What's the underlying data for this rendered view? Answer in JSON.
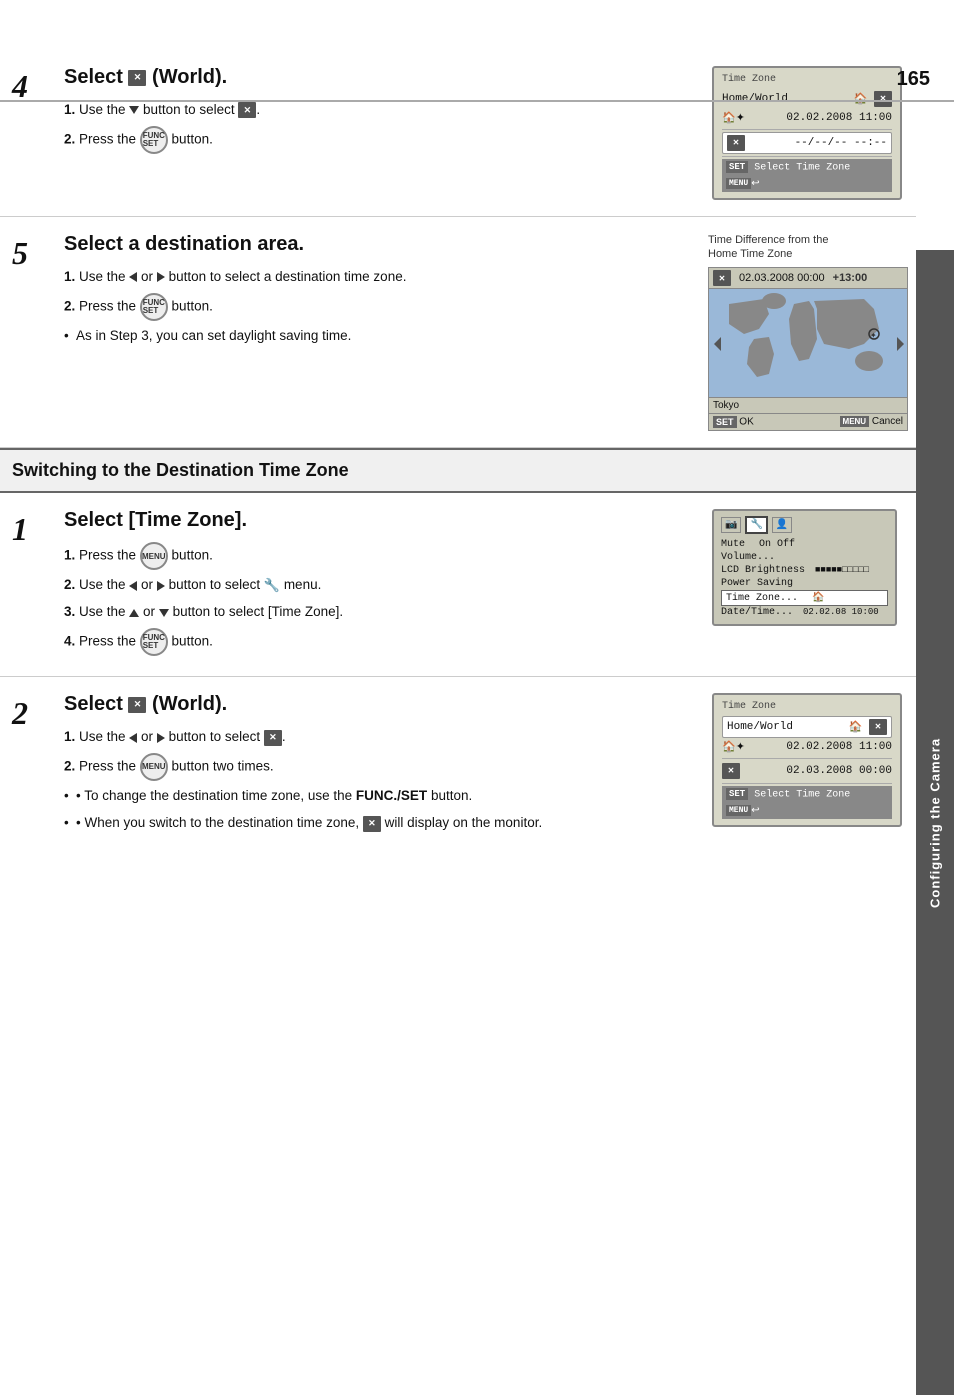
{
  "page": {
    "number": "165",
    "sidebar_label": "Configuring the Camera"
  },
  "sections": {
    "step4": {
      "num": "4",
      "title": "Select",
      "title_icon": "world",
      "title_suffix": "(World).",
      "step1_text": "Use the",
      "step1_arrow": "down-arrow",
      "step1_suffix": "button to select",
      "step1_icon": "world",
      "step2_text": "Press the",
      "step2_btn": "FUNC/SET",
      "step2_suffix": "button.",
      "screen": {
        "title": "Time Zone",
        "row1_label": "Home/World",
        "row1_icons": "home world",
        "row2_label": "02.02.2008 11:00",
        "row3_label": "--/--/-- --:--",
        "row3_selected": true,
        "bottom1": "SET Select Time Zone",
        "bottom2": "MENU"
      }
    },
    "step5": {
      "num": "5",
      "title": "Select a destination area.",
      "note_label": "Time Difference from the Home Time Zone",
      "step1_text": "Use the",
      "step1_suffix": "or",
      "step1_arrow1": "left-arrow",
      "step1_arrow2": "right-arrow",
      "step1_end": "button to select a destination time zone.",
      "step2_text": "Press the",
      "step2_btn": "FUNC/SET",
      "step2_suffix": "button.",
      "bullet1": "As in Step 3, you can set daylight saving time.",
      "screen": {
        "header": "02.03.2008 00:00  +13:00",
        "city": "Tokyo",
        "bottom_left": "SET OK",
        "bottom_right": "MENU Cancel"
      }
    },
    "switching": {
      "title": "Switching to the Destination Time Zone"
    },
    "step_s1": {
      "num": "1",
      "title": "Select [Time Zone].",
      "step1_text": "Press the",
      "step1_btn": "MENU",
      "step1_suffix": "button.",
      "step2_text": "Use the",
      "step2_a1": "left-arrow",
      "step2_or": "or",
      "step2_a2": "right-arrow",
      "step2_suffix": "button to select",
      "step2_icon": "wrench",
      "step2_end": "menu.",
      "step3_text": "Use the",
      "step3_a1": "up-arrow",
      "step3_or": "or",
      "step3_a2": "down-arrow",
      "step3_suffix": "button to select [Time Zone].",
      "step4_text": "Press the",
      "step4_btn": "FUNC/SET",
      "step4_suffix": "button.",
      "screen": {
        "tabs": [
          "camera",
          "wrench1",
          "wrench2"
        ],
        "row_mute": "Mute",
        "row_mute_val": "On Off",
        "row_volume": "Volume...",
        "row_lcd": "LCD Brightness",
        "row_lcd_bar": "■■■■■■■□□□□□",
        "row_power": "Power Saving",
        "row_timezone": "Time Zone...",
        "row_timezone_icon": "home",
        "row_datetime": "Date/Time...",
        "row_datetime_val": "02.02.08 10:00"
      }
    },
    "step_s2": {
      "num": "2",
      "title": "Select",
      "title_icon": "world",
      "title_suffix": "(World).",
      "step1_text": "Use the",
      "step1_a1": "left-arrow",
      "step1_or": "or",
      "step1_a2": "right-arrow",
      "step1_suffix": "button to select",
      "step1_icon": "world",
      "step2_text": "Press the",
      "step2_btn": "MENU",
      "step2_suffix": "button two times.",
      "bullet1": "To change the destination time zone, use the",
      "bullet1_bold": "FUNC./SET",
      "bullet1_end": "button.",
      "bullet2_pre": "When you switch to the destination time zone,",
      "bullet2_icon": "world",
      "bullet2_end": "will display on the monitor.",
      "screen": {
        "title": "Time Zone",
        "row1_label": "Home/World",
        "row1_icons": "home world",
        "row2_label": "02.02.2008 11:00",
        "row3_label": "02.03.2008 00:00",
        "bottom1": "SET Select Time Zone",
        "bottom2": "MENU"
      }
    }
  }
}
